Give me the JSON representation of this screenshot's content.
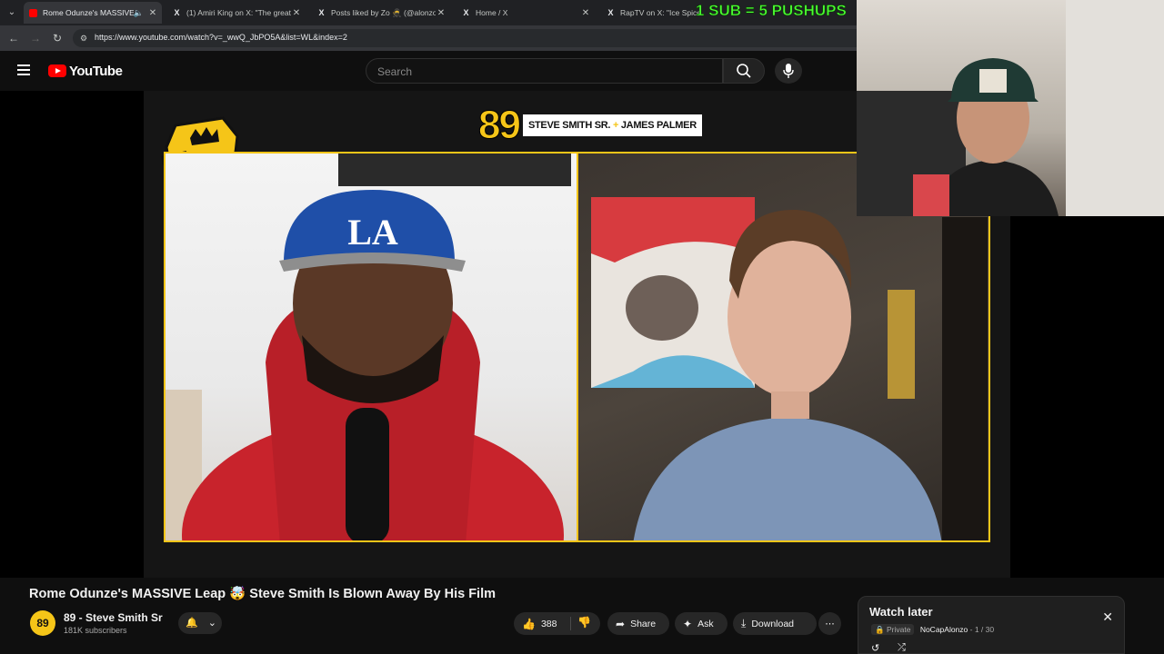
{
  "browser": {
    "tabs": [
      {
        "title": "Rome Odunze's MASSIVE Le",
        "favicon": "youtube-icon",
        "active": true,
        "audio": true
      },
      {
        "title": "(1) Amiri King on X: \"The great",
        "favicon": "x-icon",
        "active": false
      },
      {
        "title": "Posts liked by Zo 🥷 (@alonzo",
        "favicon": "x-icon",
        "active": false
      },
      {
        "title": "Home / X",
        "favicon": "x-icon",
        "active": false
      },
      {
        "title": "RapTV on X: \"Ice Spice re",
        "favicon": "x-icon",
        "active": false
      }
    ],
    "url": "https://www.youtube.com/watch?v=_wwQ_JbPO5A&list=WL&index=2"
  },
  "masthead": {
    "logo_text": "YouTube",
    "search_placeholder": "Search"
  },
  "video": {
    "banner_number": "89",
    "banner_names_left": "STEVE SMITH SR.",
    "banner_names_sep": "+",
    "banner_names_right": "JAMES PALMER",
    "badge_number": "89"
  },
  "stream_overlay": {
    "text": "1 SUB = 5 PUSHUPS",
    "text_color": "#4cff32"
  },
  "video_info": {
    "title": "Rome Odunze's MASSIVE Leap 🤯 Steve Smith Is Blown Away By His Film",
    "channel_name": "89 - Steve Smith Sr",
    "channel_avatar_text": "89",
    "subscribers": "181K subscribers",
    "like_count": "388",
    "share_label": "Share",
    "ask_label": "Ask",
    "download_label": "Download"
  },
  "watch_later": {
    "title": "Watch later",
    "privacy": "Private",
    "owner": "NoCapAlonzo",
    "position": "- 1 / 30"
  },
  "colors": {
    "accent_yellow": "#f5c518",
    "youtube_red": "#ff0000",
    "background": "#0f0f0f"
  }
}
